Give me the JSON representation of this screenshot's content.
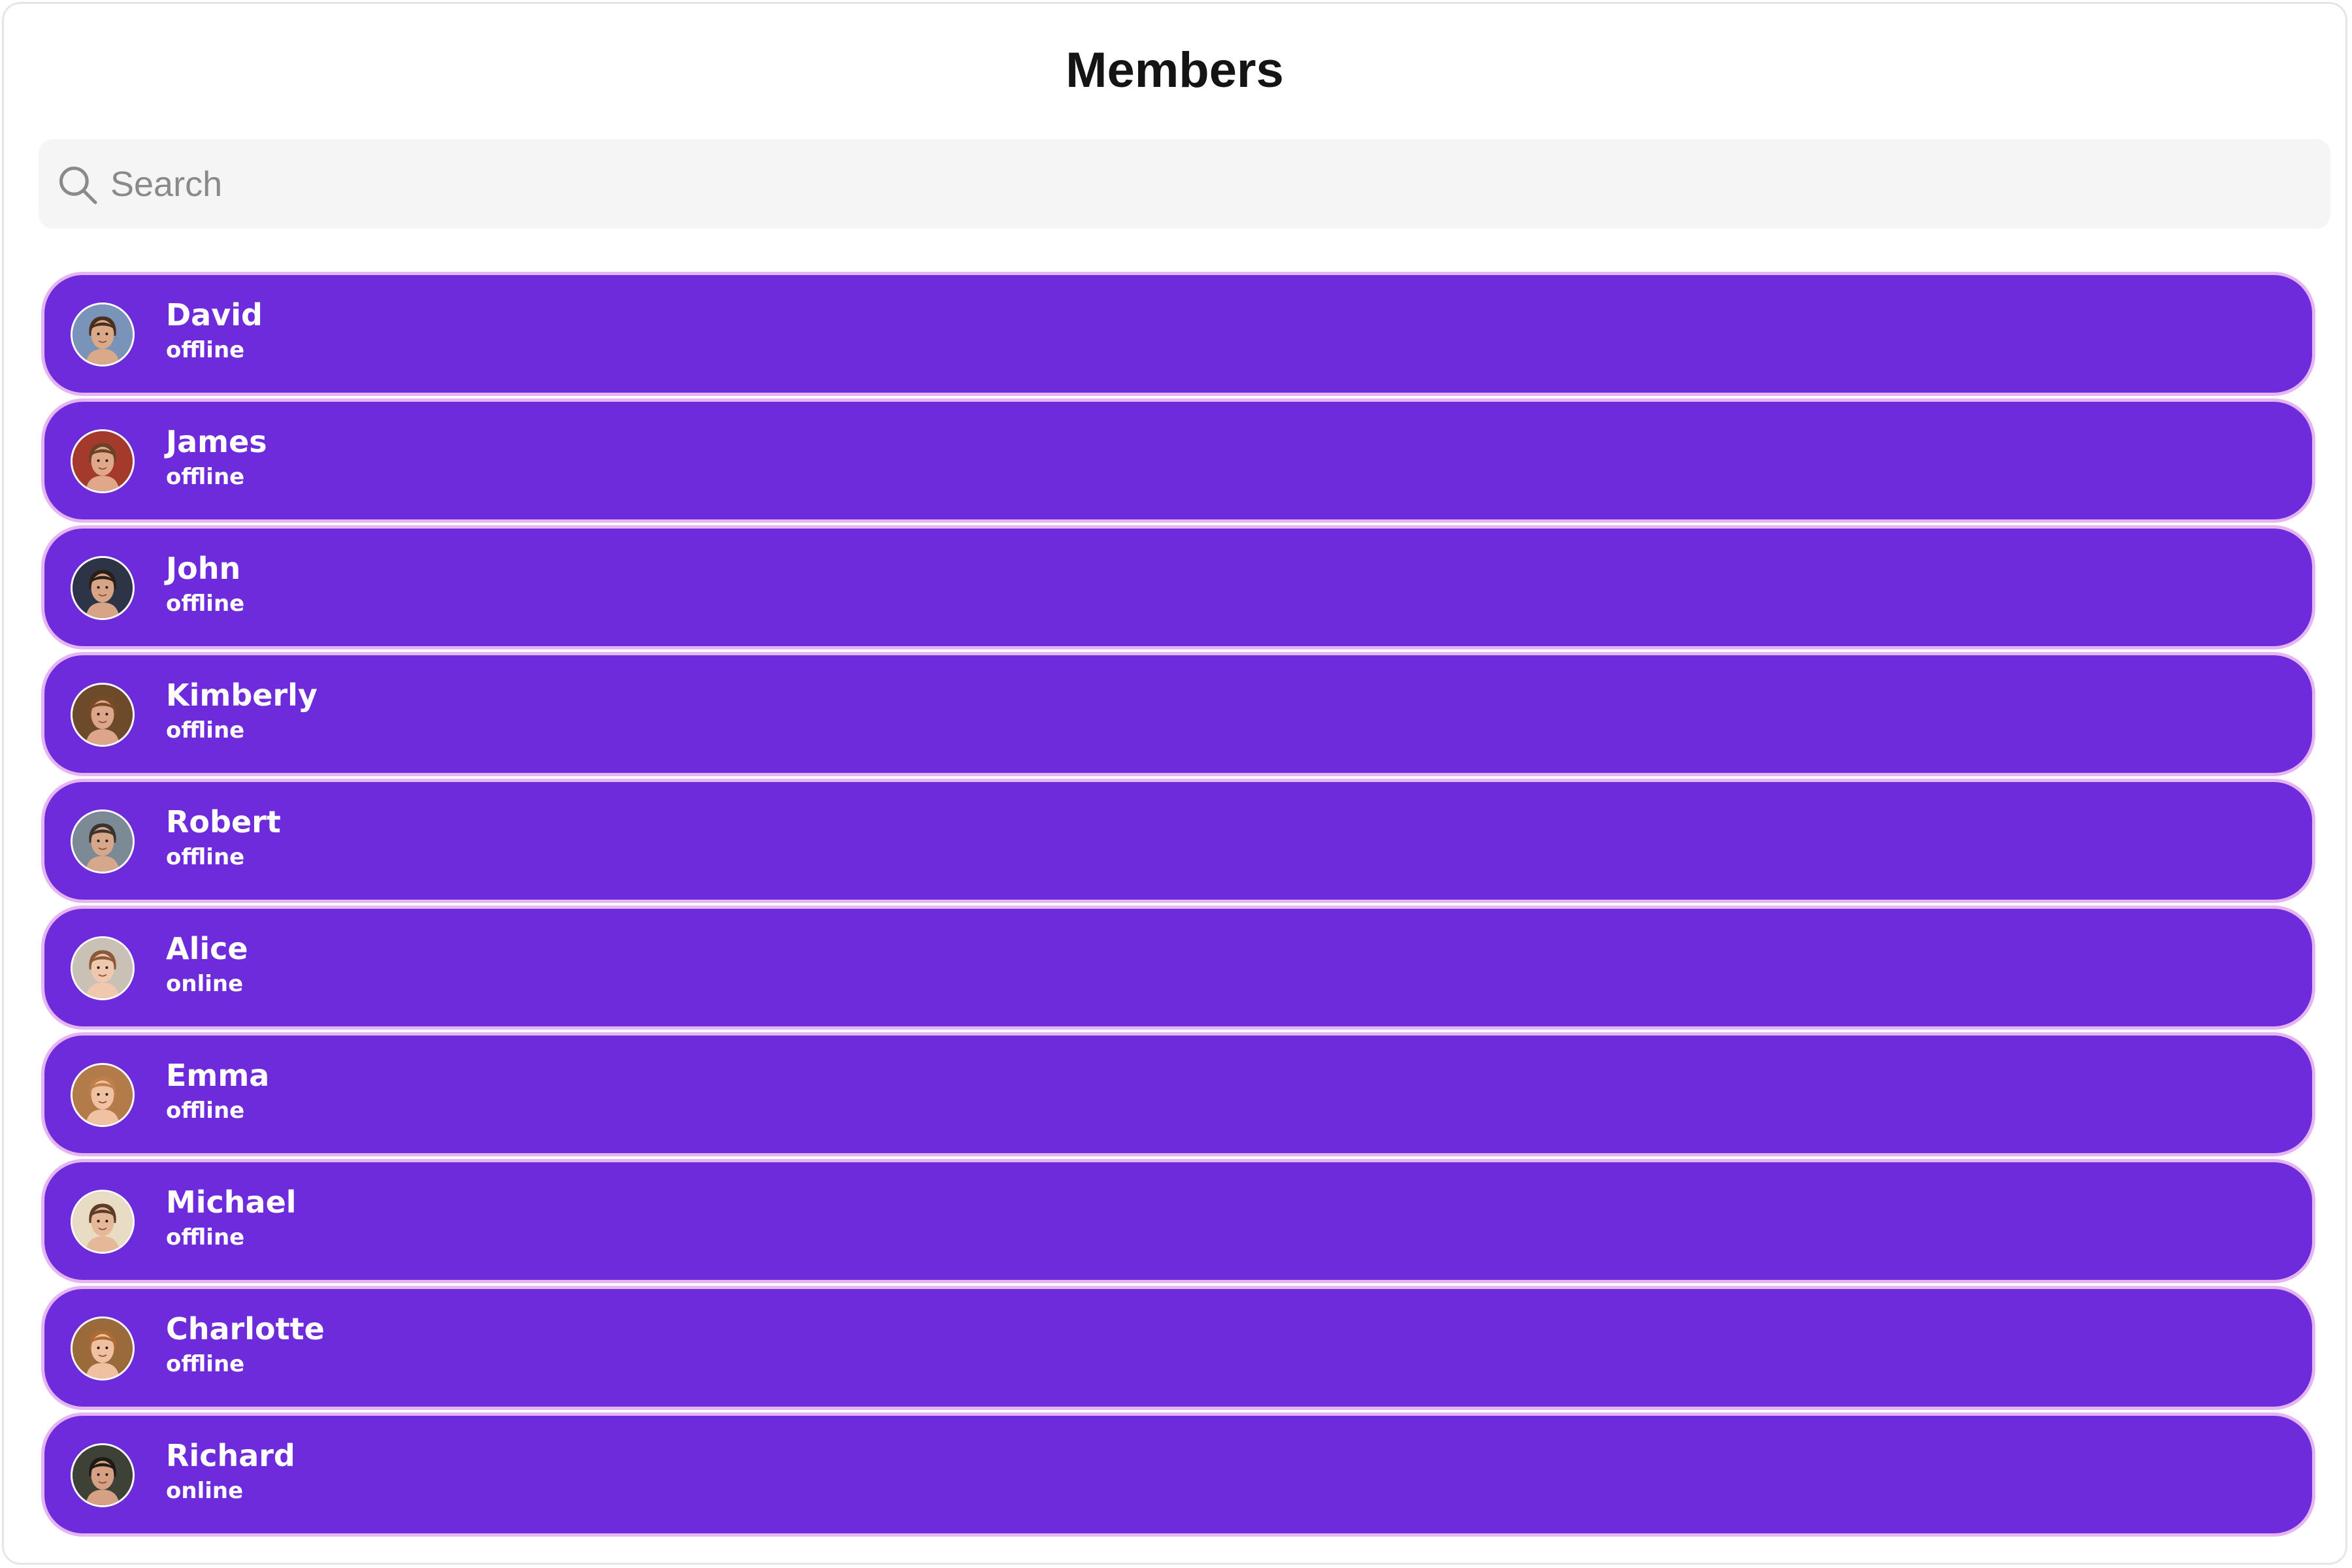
{
  "header": {
    "title": "Members"
  },
  "search": {
    "placeholder": "Search",
    "icon": "search-icon"
  },
  "colors": {
    "item_background": "#6e2bdc",
    "item_border": "#e7b4f3",
    "text_on_item": "#ffffff",
    "search_background": "#f5f5f5"
  },
  "members": [
    {
      "name": "David",
      "status": "offline",
      "avatar": {
        "bg": "#7a93b8",
        "skin": "#d9a98a",
        "hair": "#4a2f20"
      }
    },
    {
      "name": "James",
      "status": "offline",
      "avatar": {
        "bg": "#a33a2c",
        "skin": "#e0a88a",
        "hair": "#6b4128"
      }
    },
    {
      "name": "John",
      "status": "offline",
      "avatar": {
        "bg": "#2d3446",
        "skin": "#d8a487",
        "hair": "#2b2019"
      }
    },
    {
      "name": "Kimberly",
      "status": "offline",
      "avatar": {
        "bg": "#6d4a2a",
        "skin": "#dba68a",
        "hair": "#7a4a26"
      }
    },
    {
      "name": "Robert",
      "status": "offline",
      "avatar": {
        "bg": "#7c8a96",
        "skin": "#d7a78b",
        "hair": "#3a3330"
      }
    },
    {
      "name": "Alice",
      "status": "online",
      "avatar": {
        "bg": "#c9c1b6",
        "skin": "#f0c8ae",
        "hair": "#8c5a3a"
      }
    },
    {
      "name": "Emma",
      "status": "offline",
      "avatar": {
        "bg": "#b37a4a",
        "skin": "#f1c2a2",
        "hair": "#c0804a"
      }
    },
    {
      "name": "Michael",
      "status": "offline",
      "avatar": {
        "bg": "#e8dcc4",
        "skin": "#e6b89a",
        "hair": "#5a3c28"
      }
    },
    {
      "name": "Charlotte",
      "status": "offline",
      "avatar": {
        "bg": "#9a6a3a",
        "skin": "#efc1a0",
        "hair": "#b06a34"
      }
    },
    {
      "name": "Richard",
      "status": "online",
      "avatar": {
        "bg": "#3e4136",
        "skin": "#d5a084",
        "hair": "#1f1a16"
      }
    }
  ]
}
